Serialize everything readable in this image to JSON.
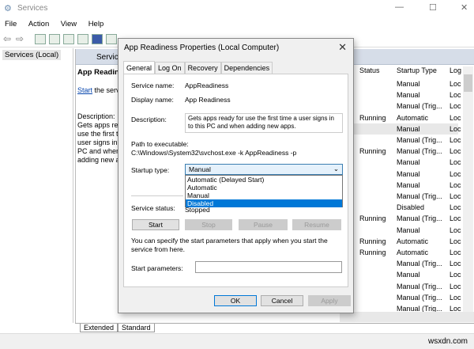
{
  "window": {
    "title": "Services",
    "min": "—",
    "max": "☐",
    "close": "✕"
  },
  "menu": [
    "File",
    "Action",
    "View",
    "Help"
  ],
  "tree": {
    "selected": "Services (Local)"
  },
  "panel": {
    "header": "Services",
    "service_title": "App Readiness",
    "start_link": "Start",
    "start_rest": " the service",
    "desc_label": "Description:",
    "desc_text": "Gets apps ready for use the first time a user signs in to this PC and when adding new apps."
  },
  "columns": {
    "status": "Status",
    "startup": "Startup Type",
    "logon": "Log"
  },
  "rows": [
    {
      "status": "",
      "startup": "Manual",
      "logon": "Loc"
    },
    {
      "status": "",
      "startup": "Manual",
      "logon": "Loc"
    },
    {
      "status": "",
      "startup": "Manual (Trig...",
      "logon": "Loc"
    },
    {
      "status": "Running",
      "startup": "Automatic",
      "logon": "Loc"
    },
    {
      "status": "",
      "startup": "Manual",
      "logon": "Loc",
      "selected": true
    },
    {
      "status": "",
      "startup": "Manual (Trig...",
      "logon": "Loc"
    },
    {
      "status": "Running",
      "startup": "Manual (Trig...",
      "logon": "Loc"
    },
    {
      "status": "",
      "startup": "Manual",
      "logon": "Loc"
    },
    {
      "status": "",
      "startup": "Manual",
      "logon": "Loc"
    },
    {
      "status": "",
      "startup": "Manual",
      "logon": "Loc"
    },
    {
      "status": "",
      "startup": "Manual (Trig...",
      "logon": "Loc"
    },
    {
      "status": "",
      "startup": "Disabled",
      "logon": "Loc"
    },
    {
      "status": "Running",
      "startup": "Manual (Trig...",
      "logon": "Loc"
    },
    {
      "status": "",
      "startup": "Manual",
      "logon": "Loc"
    },
    {
      "status": "Running",
      "startup": "Automatic",
      "logon": "Loc"
    },
    {
      "status": "Running",
      "startup": "Automatic",
      "logon": "Loc"
    },
    {
      "status": "",
      "startup": "Manual (Trig...",
      "logon": "Loc"
    },
    {
      "status": "",
      "startup": "Manual",
      "logon": "Loc"
    },
    {
      "status": "",
      "startup": "Manual (Trig...",
      "logon": "Loc"
    },
    {
      "status": "",
      "startup": "Manual (Trig...",
      "logon": "Loc"
    },
    {
      "status": "",
      "startup": "Manual (Trig...",
      "logon": "Loc"
    }
  ],
  "bottom_tabs": [
    "Extended",
    "Standard"
  ],
  "watermark": "wsxdn.com",
  "dialog": {
    "title": "App Readiness Properties (Local Computer)",
    "tabs": [
      "General",
      "Log On",
      "Recovery",
      "Dependencies"
    ],
    "service_name_label": "Service name:",
    "service_name": "AppReadiness",
    "display_name_label": "Display name:",
    "display_name": "App Readiness",
    "description_label": "Description:",
    "description": "Gets apps ready for use the first time a user signs in to this PC and when adding new apps.",
    "path_label": "Path to executable:",
    "path": "C:\\Windows\\System32\\svchost.exe -k AppReadiness -p",
    "startup_label": "Startup type:",
    "startup_value": "Manual",
    "startup_options": [
      "Automatic (Delayed Start)",
      "Automatic",
      "Manual",
      "Disabled"
    ],
    "status_label": "Service status:",
    "status_value": "Stopped",
    "buttons": {
      "start": "Start",
      "stop": "Stop",
      "pause": "Pause",
      "resume": "Resume",
      "ok": "OK",
      "cancel": "Cancel",
      "apply": "Apply"
    },
    "hint": "You can specify the start parameters that apply when you start the service from here.",
    "params_label": "Start parameters:",
    "params_value": ""
  },
  "colors": {
    "accent": "#0078d7",
    "header": "#d6dde8"
  }
}
